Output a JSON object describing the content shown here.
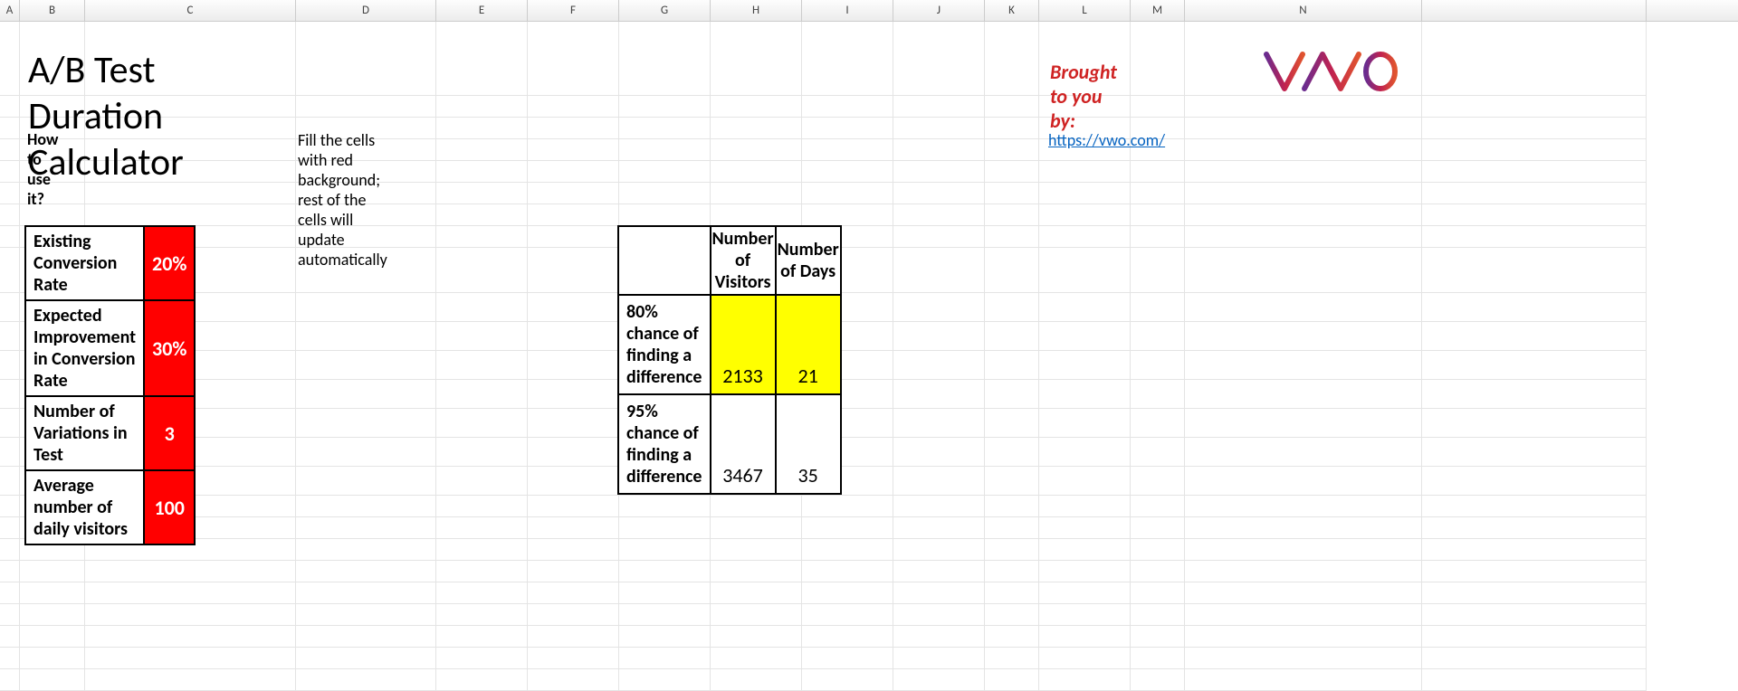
{
  "columns": [
    "A",
    "B",
    "C",
    "D",
    "E",
    "F",
    "G",
    "H",
    "I",
    "J",
    "K",
    "L",
    "M",
    "N"
  ],
  "title": "A/B Test Duration Calculator",
  "brought_by": "Brought to you by:",
  "logo_text": "VWO",
  "howto_question": "How to use it?",
  "howto_answer": "Fill the cells with red background; rest of the cells will update automatically",
  "link_text": "https://vwo.com/",
  "inputs": {
    "rows": [
      {
        "label": "Existing Conversion Rate",
        "value": "20%"
      },
      {
        "label": "Expected Improvement in Conversion Rate",
        "value": "30%"
      },
      {
        "label": "Number of Variations in Test",
        "value": "3"
      },
      {
        "label": "Average number of daily visitors",
        "value": "100"
      }
    ]
  },
  "outputs": {
    "header_visitors": "Number of Visitors",
    "header_days": "Number of Days",
    "rows": [
      {
        "label": "80% chance of finding a difference",
        "visitors": "2133",
        "days": "21"
      },
      {
        "label": "95% chance of finding a difference",
        "visitors": "3467",
        "days": "35"
      }
    ]
  }
}
